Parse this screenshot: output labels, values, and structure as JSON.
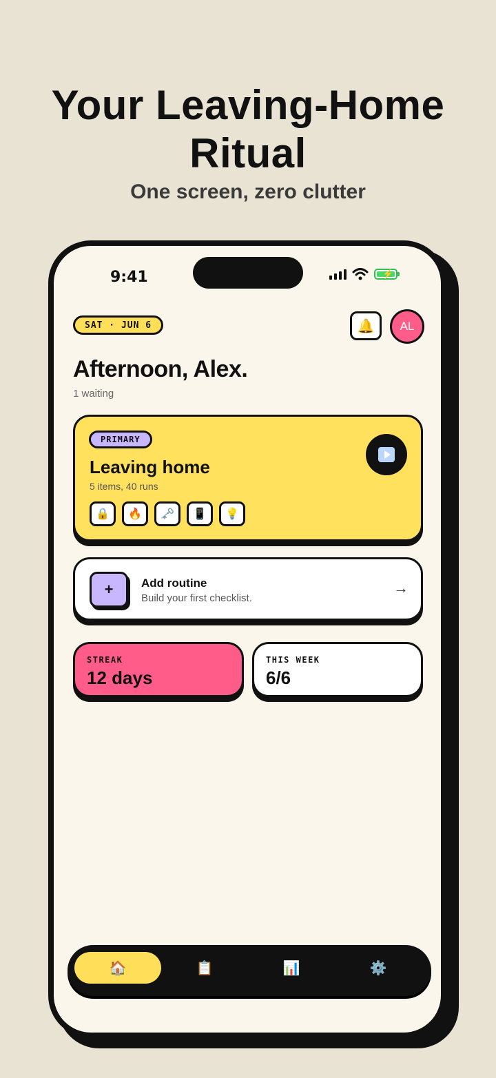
{
  "headline": "Your Leaving-Home Ritual",
  "subheadline": "One screen, zero clutter",
  "status_bar": {
    "time": "9:41"
  },
  "header": {
    "date": "SAT · JUN 6",
    "bell_icon": "🔔",
    "avatar_initials": "AL",
    "greeting": "Afternoon, Alex.",
    "waiting": "1 waiting"
  },
  "primary_routine": {
    "badge": "PRIMARY",
    "title": "Leaving home",
    "meta": "5 items, 40 runs",
    "items": [
      {
        "icon": "🔒",
        "name": "lock-icon"
      },
      {
        "icon": "🔥",
        "name": "fire-icon"
      },
      {
        "icon": "🗝️",
        "name": "key-icon"
      },
      {
        "icon": "📱",
        "name": "phone-icon"
      },
      {
        "icon": "💡",
        "name": "lightbulb-icon"
      }
    ]
  },
  "add_routine": {
    "plus": "+",
    "title": "Add routine",
    "subtitle": "Build your first checklist.",
    "arrow": "→"
  },
  "stats": {
    "streak_label": "STREAK",
    "streak_value": "12 days",
    "week_label": "THIS WEEK",
    "week_value": "6/6"
  },
  "tabs": [
    {
      "icon": "🏠",
      "name": "home-icon",
      "active": true
    },
    {
      "icon": "📋",
      "name": "clipboard-icon",
      "active": false
    },
    {
      "icon": "📊",
      "name": "bar-chart-icon",
      "active": false
    },
    {
      "icon": "⚙️",
      "name": "gear-icon",
      "active": false
    }
  ],
  "colors": {
    "background": "#e8e3d3",
    "screen": "#faf6ec",
    "yellow": "#ffdf5a",
    "pink": "#ff5c8a",
    "lavender": "#c8b6ff",
    "ink": "#111111"
  }
}
